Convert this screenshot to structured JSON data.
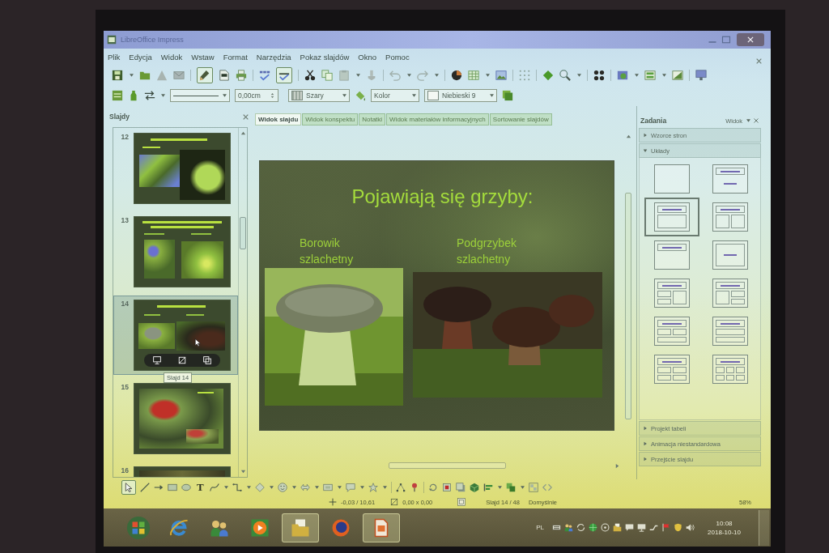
{
  "window": {
    "title": "LibreOffice Impress"
  },
  "menu": [
    "Plik",
    "Edycja",
    "Widok",
    "Wstaw",
    "Format",
    "Narzędzia",
    "Pokaz slajdów",
    "Okno",
    "Pomoc"
  ],
  "standard_toolbar": {
    "edit_file": true,
    "auto_spellcheck": true
  },
  "line_toolbar": {
    "line_width": "0,00cm",
    "line_color": "Szary",
    "area_style": "Kolor",
    "area_color": "Niebieski 9"
  },
  "slides_pane": {
    "title": "Slajdy",
    "slides": [
      {
        "number": "12",
        "selected": false
      },
      {
        "number": "13",
        "selected": false
      },
      {
        "number": "14",
        "selected": true
      },
      {
        "number": "15",
        "selected": false
      },
      {
        "number": "16",
        "selected": false
      }
    ],
    "tooltip": "Slajd 14"
  },
  "view_tabs": [
    {
      "label": "Widok slajdu",
      "selected": true
    },
    {
      "label": "Widok konspektu",
      "selected": false
    },
    {
      "label": "Notatki",
      "selected": false
    },
    {
      "label": "Widok materiałów informacyjnych",
      "selected": false
    },
    {
      "label": "Sortowanie slajdów",
      "selected": false
    }
  ],
  "slide": {
    "title": "Pojawiają się grzyby:",
    "columns": [
      {
        "caption": "Borowik szlachetny"
      },
      {
        "caption": "Podgrzybek szlachetny"
      }
    ]
  },
  "task_pane": {
    "title": "Zadania",
    "view_menu": "Widok",
    "sections": [
      {
        "label": "Wzorce stron",
        "expanded": false
      },
      {
        "label": "Układy",
        "expanded": true,
        "layouts": [
          {
            "kind": "blank",
            "selected": false
          },
          {
            "kind": "title-subtitle",
            "selected": false
          },
          {
            "kind": "title-content",
            "selected": true
          },
          {
            "kind": "title-2-content",
            "selected": false
          },
          {
            "kind": "title-only",
            "selected": false
          },
          {
            "kind": "centered-text",
            "selected": false
          },
          {
            "kind": "title-2content-content",
            "selected": false
          },
          {
            "kind": "title-content-2content",
            "selected": false
          },
          {
            "kind": "title-2content-over-content",
            "selected": false
          },
          {
            "kind": "title-content-over-content",
            "selected": false
          },
          {
            "kind": "title-4-content",
            "selected": false
          },
          {
            "kind": "title-6-content",
            "selected": false
          }
        ]
      },
      {
        "label": "Projekt tabeli",
        "expanded": false
      },
      {
        "label": "Animacja niestandardowa",
        "expanded": false
      },
      {
        "label": "Przejście slajdu",
        "expanded": false
      }
    ]
  },
  "drawing_toolbar": {
    "select": true,
    "text_tool": "T"
  },
  "status_bar": {
    "position": "-0,03 / 10,61",
    "size": "0,00 x 0,00",
    "slide": "Slajd 14 / 48",
    "master": "Domyślnie",
    "zoom": "58%"
  },
  "taskbar": {
    "apps": [
      {
        "kind": "browser",
        "active": false
      },
      {
        "kind": "people",
        "active": false
      },
      {
        "kind": "player",
        "active": false
      },
      {
        "kind": "folder",
        "active": true
      },
      {
        "kind": "fox",
        "active": false
      },
      {
        "kind": "document",
        "active": true
      }
    ],
    "tray": {
      "language": "PL",
      "time": "10:08",
      "date": "2018-10-10"
    }
  }
}
